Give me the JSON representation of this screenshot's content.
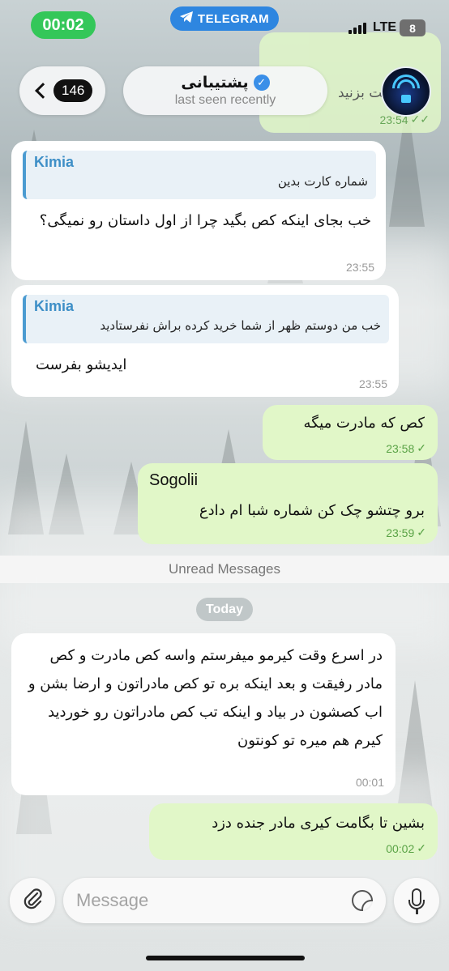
{
  "status_bar": {
    "time": "00:02",
    "app_pill": "TELEGRAM",
    "network": "LTE",
    "battery": "8"
  },
  "header": {
    "back_count": "146",
    "chat_name": "پشتیبانی",
    "verified_icon": "✓",
    "last_seen": "last seen recently"
  },
  "background_fragments": {
    "top_partial_text": "ام برگشت بزنید",
    "top_partial_time": "23:54"
  },
  "messages": [
    {
      "direction": "in",
      "reply_to": {
        "name": "Kimia",
        "text": "شماره کارت بدین"
      },
      "text": "خب بجای اینکه کص بگید چرا از اول داستان رو نمیگی؟",
      "time": "23:55"
    },
    {
      "direction": "in",
      "reply_to": {
        "name": "Kimia",
        "text": "خب من دوستم ظهر از شما خرید کرده براش نفرستادید"
      },
      "text": "ایدیشو بفرست",
      "time": "23:55"
    },
    {
      "direction": "out",
      "text": "کص که مادرت میگه",
      "time": "23:58"
    },
    {
      "direction": "out",
      "sender": "Sogolii",
      "text": "برو چتشو چک کن شماره شبا ام دادع",
      "time": "23:59"
    },
    {
      "direction": "in",
      "text": "در اسرع وقت کیرمو میفرستم واسه کص مادرت و کص مادر رفیقت و بعد اینکه بره تو کص مادراتون و ارضا بشن و اب کصشون در بیاد و اینکه تب کص مادراتون رو خوردید کیرم هم میره تو کونتون",
      "time": "00:01"
    },
    {
      "direction": "out",
      "text": "بشین تا بگامت کیری مادر جنده دزد",
      "time": "00:02"
    }
  ],
  "unread_label": "Unread Messages",
  "date_label": "Today",
  "composer": {
    "placeholder": "Message"
  },
  "colors": {
    "incoming_bubble": "#ffffff",
    "outgoing_bubble": "#e1f7c8",
    "accent": "#3e8fc7",
    "status_green": "#34c759",
    "telegram_blue": "#2e86e0"
  },
  "icons": [
    "paperclip-icon",
    "sticker-icon",
    "microphone-icon",
    "chevron-left-icon",
    "verified-icon",
    "read-checkmark-icon",
    "telegram-icon"
  ]
}
